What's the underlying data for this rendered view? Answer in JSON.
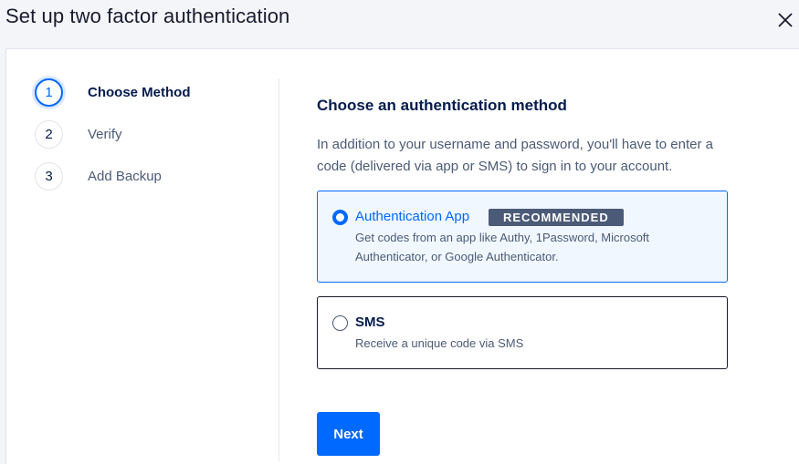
{
  "modal": {
    "title": "Set up two factor authentication",
    "close_icon": "close-icon"
  },
  "steps": [
    {
      "number": "1",
      "label": "Choose Method",
      "active": true
    },
    {
      "number": "2",
      "label": "Verify",
      "active": false
    },
    {
      "number": "3",
      "label": "Add Backup",
      "active": false
    }
  ],
  "main": {
    "heading": "Choose an authentication method",
    "description": "In addition to your username and password, you'll have to enter a code (delivered via app or SMS) to sign in to your account.",
    "options": [
      {
        "title": "Authentication App",
        "badge": "RECOMMENDED",
        "subtitle": "Get codes from an app like Authy, 1Password, Microsoft Authenticator, or Google Authenticator.",
        "selected": true
      },
      {
        "title": "SMS",
        "subtitle": "Receive a unique code via SMS",
        "selected": false
      }
    ],
    "next_label": "Next"
  },
  "colors": {
    "accent": "#0069ff",
    "text": "#031b4e",
    "muted": "#4b5a77",
    "selected_bg": "#f1f7ff"
  }
}
